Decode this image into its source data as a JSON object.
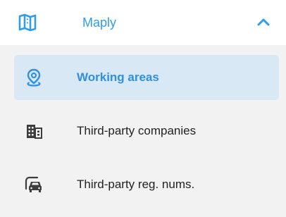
{
  "section": {
    "label": "Maply",
    "icon": "map-icon",
    "expanded": true,
    "accent_color": "#2f9ee6"
  },
  "items": [
    {
      "label": "Working areas",
      "icon": "location-pin-icon",
      "active": true
    },
    {
      "label": "Third-party companies",
      "icon": "building-icon",
      "active": false
    },
    {
      "label": "Third-party reg. nums.",
      "icon": "car-icon",
      "active": false
    }
  ],
  "colors": {
    "active_bg": "#d9e8f5",
    "submenu_bg": "#f2f2f2",
    "text": "#222222"
  }
}
